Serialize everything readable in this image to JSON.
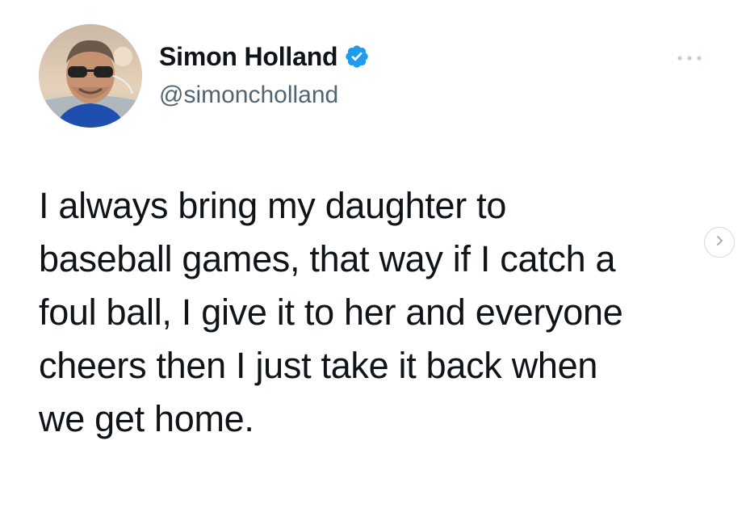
{
  "tweet": {
    "author": {
      "display_name": "Simon Holland",
      "handle": "@simoncholland",
      "verified": true
    },
    "text": "I always bring my daughter to\nbaseball games, that way if I catch a\nfoul ball, I give it to her and everyone\ncheers then I just take it back when\nwe get home."
  },
  "icons": {
    "verified": "verified-badge-icon",
    "more": "more-options-icon",
    "next": "chevron-right-icon"
  },
  "colors": {
    "verified_badge": "#1d9bf0",
    "handle_text": "#536471",
    "body_text": "#0f1419"
  }
}
